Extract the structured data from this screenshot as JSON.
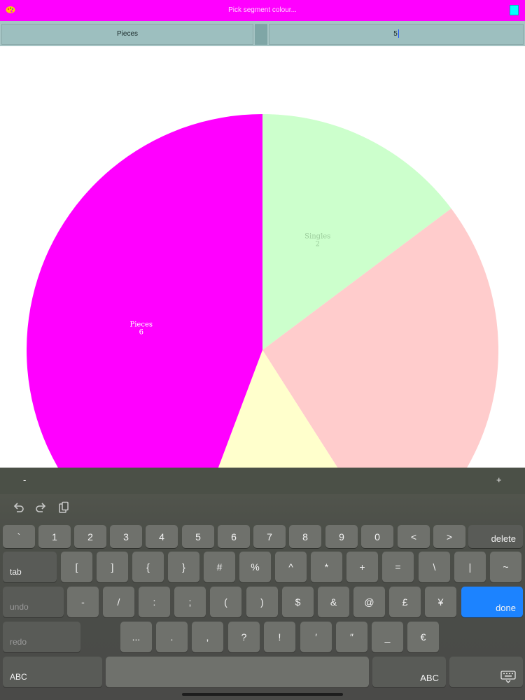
{
  "topbar": {
    "title": "Pick segment colour...",
    "app_icon": "palette-icon",
    "swatch_color": "#00ffff",
    "background": "#ff00ff"
  },
  "editor": {
    "name_value": "Pieces",
    "count_value": "5"
  },
  "chart_data": {
    "type": "pie",
    "slices": [
      {
        "name": "Singles",
        "value": 2,
        "color": "#ccffcc",
        "label_color": "#9ccd9c"
      },
      {
        "name": "",
        "value": 3.55,
        "color": "#ffcccc",
        "label_color": "#d9a3a3"
      },
      {
        "name": "",
        "value": 2.0,
        "color": "#ffffcc",
        "label_color": "#c9c999"
      },
      {
        "name": "Pieces",
        "value": 6,
        "color": "#ff00ff",
        "label_color": "#ffffff"
      }
    ],
    "labels": [
      {
        "name": "Singles",
        "value": "2"
      },
      {
        "name": "Pieces",
        "value": "6"
      }
    ]
  },
  "keyboard": {
    "accessory": {
      "minus": "-",
      "plus": "+"
    },
    "row1": [
      "`",
      "1",
      "2",
      "3",
      "4",
      "5",
      "6",
      "7",
      "8",
      "9",
      "0",
      "<",
      ">"
    ],
    "delete": "delete",
    "tab": "tab",
    "row2": [
      "[",
      "]",
      "{",
      "}",
      "#",
      "%",
      "^",
      "*",
      "+",
      "=",
      "\\",
      "|",
      "~"
    ],
    "undo": "undo",
    "row3": [
      "-",
      "/",
      ":",
      ";",
      "(",
      ")",
      "$",
      "&",
      "@",
      "£",
      "¥"
    ],
    "done": "done",
    "redo": "redo",
    "row4": [
      "...",
      ".",
      ",",
      "?",
      "!",
      "′",
      "″",
      "_",
      "€"
    ],
    "abc_left": "ABC",
    "abc_right": "ABC"
  }
}
